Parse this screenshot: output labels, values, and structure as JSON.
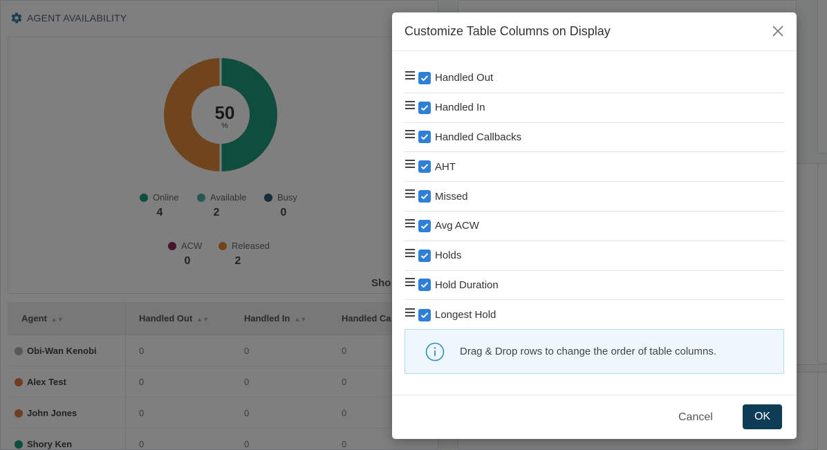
{
  "dashboard": {
    "panel_title": "AGENT AVAILABILITY",
    "donut": {
      "value": "50",
      "unit": "%",
      "online_color": "#1e9a7e",
      "released_color": "#e08a3a"
    },
    "legend": [
      {
        "label": "Online",
        "value": "4",
        "color": "#1e9a7e"
      },
      {
        "label": "Available",
        "value": "2",
        "color": "#4fb3a8"
      },
      {
        "label": "Busy",
        "value": "0",
        "color": "#2e5a7a"
      },
      {
        "label": "ACW",
        "value": "0",
        "color": "#8a2c56"
      },
      {
        "label": "Released",
        "value": "2",
        "color": "#e08a3a"
      }
    ],
    "show_text": "Sho",
    "table": {
      "headers": [
        "Agent",
        "Handled Out",
        "Handled In",
        "Handled Ca"
      ],
      "rows": [
        {
          "agent": "Obi-Wan Kenobi",
          "status_color": "#b0b0b0",
          "cells": [
            "0",
            "0",
            "0"
          ]
        },
        {
          "agent": "Alex Test",
          "status_color": "#e07a40",
          "cells": [
            "0",
            "0",
            "0"
          ]
        },
        {
          "agent": "John Jones",
          "status_color": "#e07a40",
          "cells": [
            "0",
            "0",
            "0"
          ]
        },
        {
          "agent": "Shory Ken",
          "status_color": "#1e9a7e",
          "cells": [
            "0",
            "0",
            "0"
          ]
        }
      ]
    }
  },
  "modal": {
    "title": "Customize Table Columns on Display",
    "columns": [
      {
        "label": "Handled Out",
        "checked": true
      },
      {
        "label": "Handled In",
        "checked": true
      },
      {
        "label": "Handled Callbacks",
        "checked": true
      },
      {
        "label": "AHT",
        "checked": true
      },
      {
        "label": "Missed",
        "checked": true
      },
      {
        "label": "Avg ACW",
        "checked": true
      },
      {
        "label": "Holds",
        "checked": true
      },
      {
        "label": "Hold Duration",
        "checked": true
      },
      {
        "label": "Longest Hold",
        "checked": true
      }
    ],
    "info_text": "Drag & Drop rows to change the order of table columns.",
    "cancel_label": "Cancel",
    "ok_label": "OK",
    "accent_color": "#2f7fd8",
    "ok_color": "#0d3c56"
  }
}
